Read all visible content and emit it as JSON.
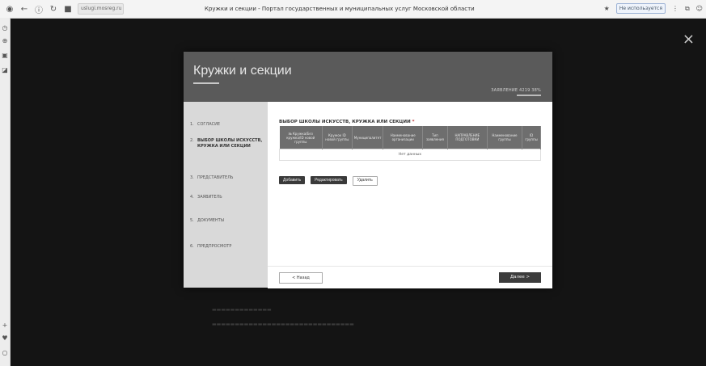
{
  "browser": {
    "url": "uslugi.mosreg.ru",
    "page_title": "Кружки и секции - Портал государственных и муниципальных услуг Московской области",
    "right_pill": "Не используется",
    "icons": [
      "back-icon",
      "info-icon",
      "reload-icon",
      "lock-icon",
      "bookmark-icon",
      "menu-icon",
      "extensions-icon",
      "profile-icon"
    ]
  },
  "modal": {
    "title": "Кружки и секции",
    "application_no": "ЗАЯВЛЕНИЕ 4219 38%",
    "steps": [
      {
        "num": "1.",
        "label": "СОГЛАСИЕ"
      },
      {
        "num": "2.",
        "label": "ВЫБОР ШКОЛЫ ИСКУССТВ, КРУЖКА ИЛИ СЕКЦИИ"
      },
      {
        "num": "3.",
        "label": "ПРЕДСТАВИТЕЛЬ"
      },
      {
        "num": "4.",
        "label": "ЗАЯВИТЕЛЬ"
      },
      {
        "num": "5.",
        "label": "ДОКУМЕНТЫ"
      },
      {
        "num": "6.",
        "label": "ПРЕДПРОСМОТР"
      }
    ],
    "section_title": "ВЫБОР ШКОЛЫ ИСКУССТВ, КРУЖКА ИЛИ СЕКЦИИ",
    "required_mark": "*",
    "table": {
      "columns": [
        "№ Кружка/Без кружка/ID новой группы",
        "Кружок ID новой группы",
        "Муниципалитет",
        "Наименование организации",
        "Тип заявления",
        "НАПРАВЛЕНИЕ ПОДГОТОВКИ",
        "Наименование группы",
        "ID группы"
      ],
      "empty_text": "Нет данных"
    },
    "buttons": {
      "add": "Добавить",
      "edit": "Редактировать",
      "delete": "Удалить"
    },
    "footer": {
      "back": "< Назад",
      "next": "Далее >"
    }
  },
  "close_label": "×"
}
